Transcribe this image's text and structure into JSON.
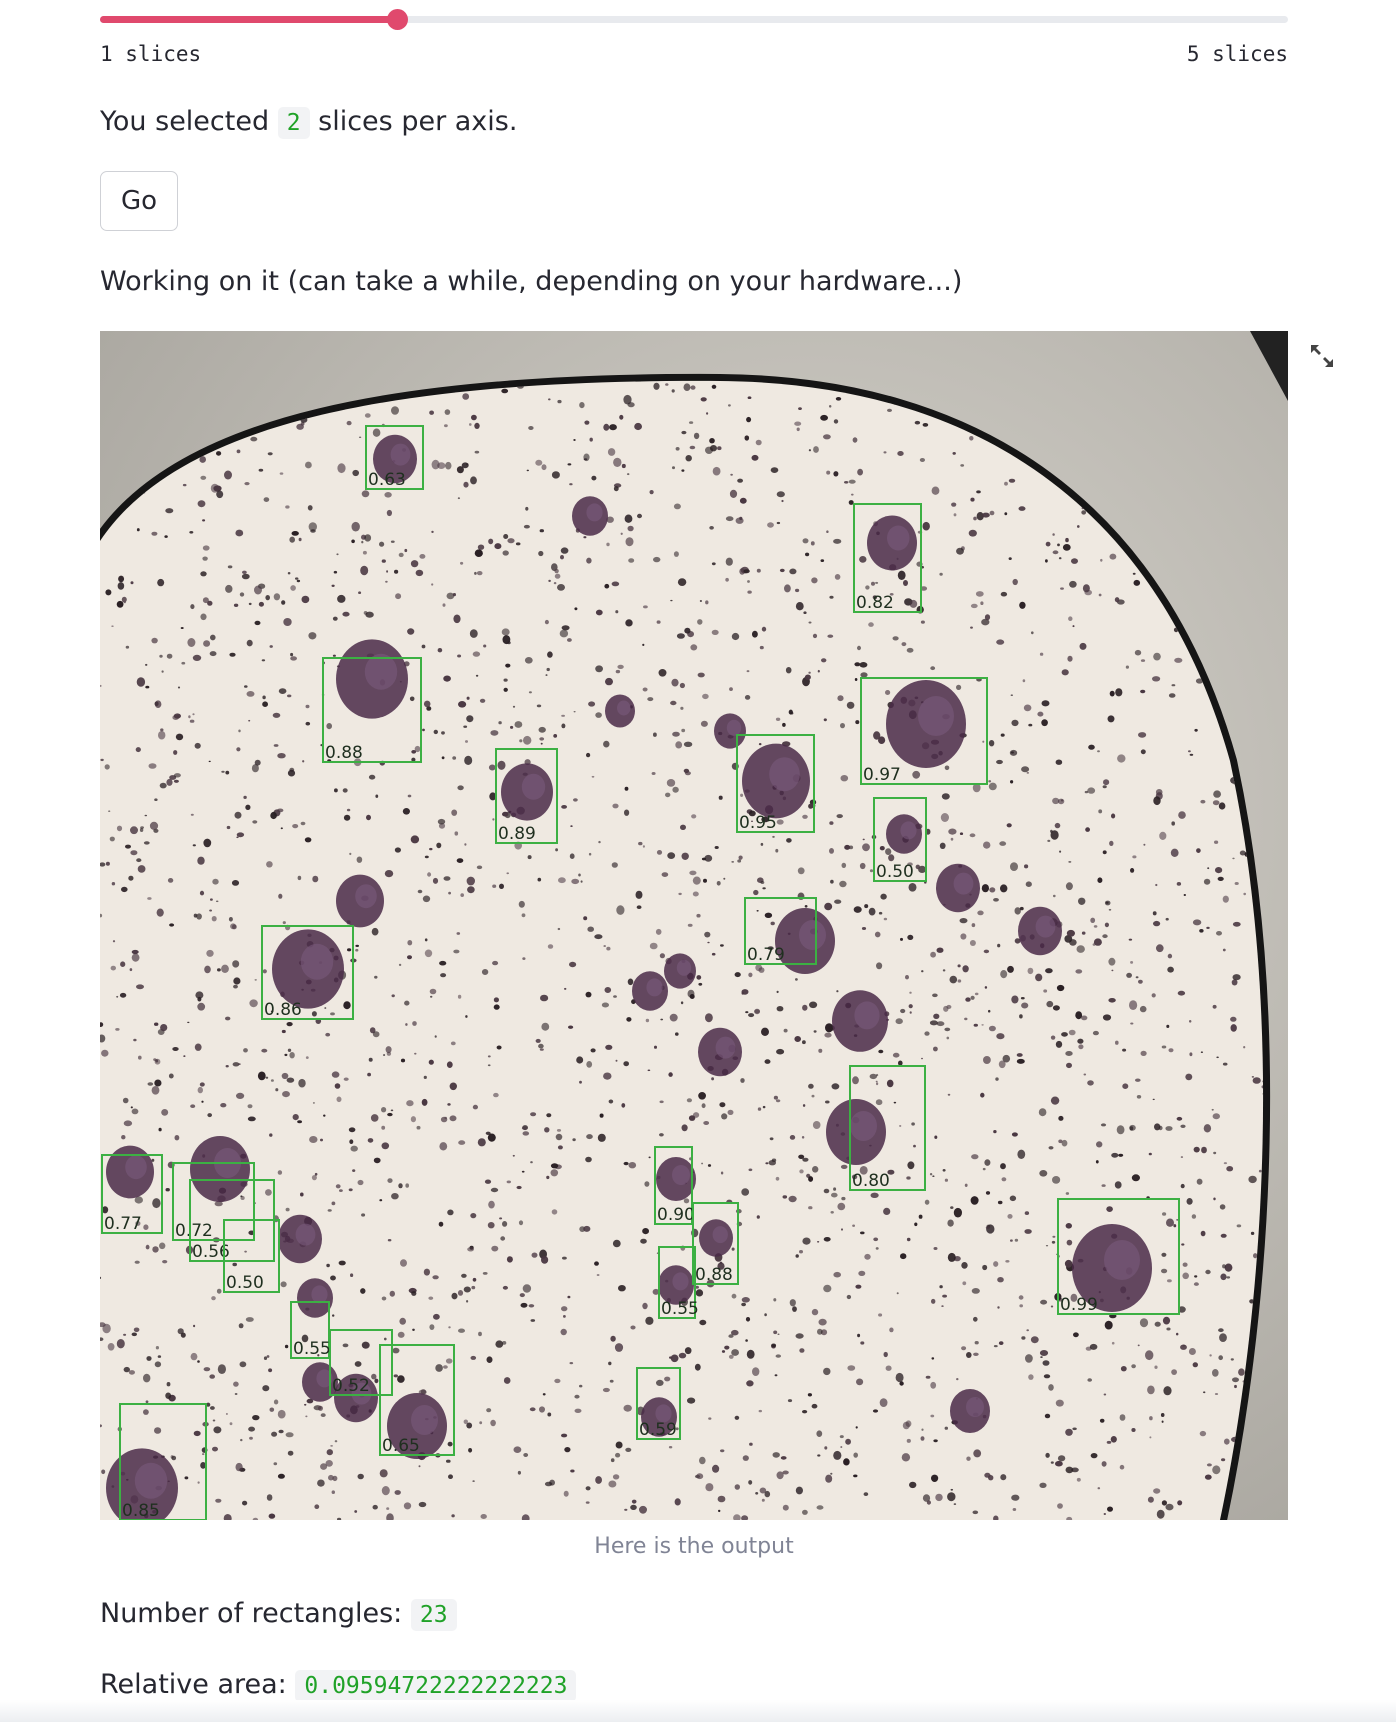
{
  "slider": {
    "min_label": "1 slices",
    "max_label": "5 slices",
    "value": 2,
    "min": 1,
    "max": 5,
    "accent_color": "#e0496d"
  },
  "selection": {
    "prefix": "You selected",
    "value": "2",
    "suffix": "slices per axis."
  },
  "go_button": {
    "label": "Go"
  },
  "status_text": "Working on it (can take a while, depending on your hardware...)",
  "output_image": {
    "caption": "Here is the output",
    "fullscreen_icon": "expand-icon",
    "detections": [
      {
        "label": "0.63"
      },
      {
        "label": "0.82"
      },
      {
        "label": "0.88"
      },
      {
        "label": "0.97"
      },
      {
        "label": "0.89"
      },
      {
        "label": "0.95"
      },
      {
        "label": "0.50"
      },
      {
        "label": "0.79"
      },
      {
        "label": "0.86"
      },
      {
        "label": "0.80"
      },
      {
        "label": "0.77"
      },
      {
        "label": "0.72"
      },
      {
        "label": "0.56"
      },
      {
        "label": "0.50"
      },
      {
        "label": "0.90"
      },
      {
        "label": "0.88"
      },
      {
        "label": "0.55"
      },
      {
        "label": "0.99"
      },
      {
        "label": "0.55"
      },
      {
        "label": "0.52"
      },
      {
        "label": "0.65"
      },
      {
        "label": "0.59"
      },
      {
        "label": "0.85"
      }
    ]
  },
  "results": {
    "rectangles_label": "Number of rectangles:",
    "rectangles_value": "23",
    "area_label": "Relative area:",
    "area_value": "0.09594722222222223"
  }
}
